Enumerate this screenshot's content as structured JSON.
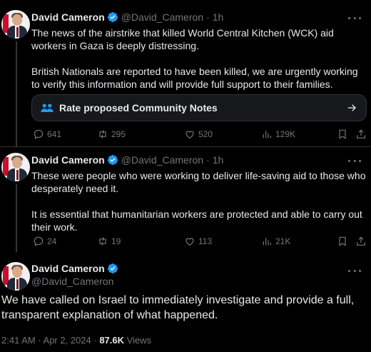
{
  "accent": "#1d9bf0",
  "tweets": [
    {
      "name": "David Cameron",
      "handle": "@David_Cameron",
      "dot": "·",
      "time": "1h",
      "text": "The news of the airstrike that killed World Central Kitchen (WCK) aid workers in Gaza is deeply distressing.\n\nBritish Nationals are reported to have been killed, we are urgently working to verify this information and will provide full support to their families.",
      "community_notes": {
        "label": "Rate proposed Community Notes",
        "icon": "people-icon"
      },
      "replies": "641",
      "reposts": "295",
      "likes": "520",
      "views": "129K"
    },
    {
      "name": "David Cameron",
      "handle": "@David_Cameron",
      "dot": "·",
      "time": "1h",
      "text": "These were people who were working to deliver life-saving aid to those who desperately need it.\n\nIt is essential that humanitarian workers are protected and able to carry out their work.",
      "replies": "24",
      "reposts": "19",
      "likes": "113",
      "views": "21K"
    }
  ],
  "main_tweet": {
    "name": "David Cameron",
    "handle": "@David_Cameron",
    "text": "We have called on Israel to immediately investigate and provide a full, transparent explanation of what happened.",
    "timestamp": "2:41 AM · Apr 2, 2024 · ",
    "views_count": "87.6K",
    "views_label": " Views"
  }
}
